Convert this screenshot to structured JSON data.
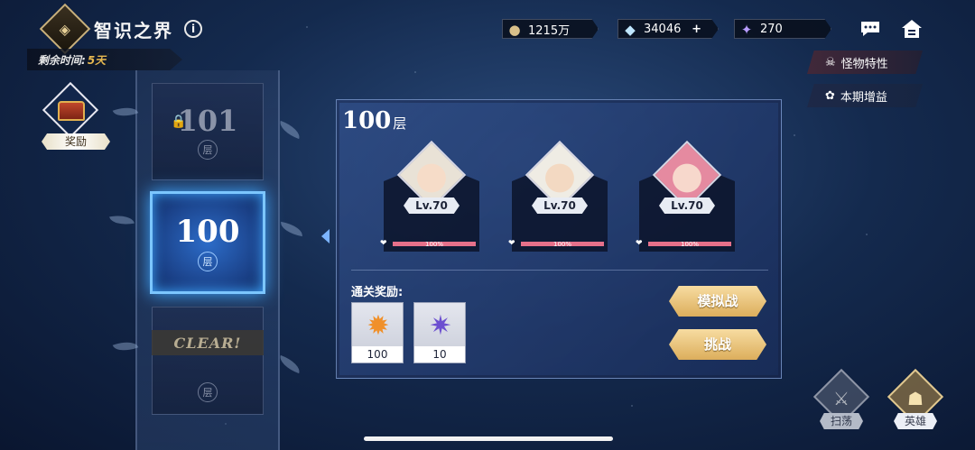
{
  "header": {
    "emblem_icon": "realm-emblem-icon",
    "title": "智识之界",
    "info_icon": "info-icon",
    "time_label": "剩余时间:",
    "time_value": "5天"
  },
  "currencies": [
    {
      "icon": "coin-icon",
      "value": "1215万"
    },
    {
      "icon": "crystal-icon",
      "value": "34046",
      "plus": "+"
    },
    {
      "icon": "star-shard-icon",
      "value": "270"
    }
  ],
  "top_right": {
    "chat_icon": "chat-icon",
    "home_icon": "home-icon"
  },
  "side_buttons": {
    "monster_traits": "怪物特性",
    "period_buff": "本期增益"
  },
  "reward_chest": {
    "label": "奖励"
  },
  "tower": {
    "locked_floor": {
      "number": "101",
      "unit": "层"
    },
    "active_floor": {
      "number": "100",
      "unit": "层"
    },
    "cleared_floor": {
      "unit": "层",
      "clear_text": "CLEAR!"
    }
  },
  "panel": {
    "floor_number": "100",
    "floor_unit": "层",
    "enemies": [
      {
        "level": "Lv.70",
        "hp_percent": 100,
        "hp_text": "100%"
      },
      {
        "level": "Lv.70",
        "hp_percent": 100,
        "hp_text": "100%"
      },
      {
        "level": "Lv.70",
        "hp_percent": 100,
        "hp_text": "100%"
      }
    ],
    "rewards_label": "通关奖励:",
    "rewards": [
      {
        "icon": "sun-medal-icon",
        "qty": "100"
      },
      {
        "icon": "star-shard-icon",
        "qty": "10"
      }
    ],
    "simulate_button": "模拟战",
    "challenge_button": "挑战"
  },
  "corner_buttons": {
    "sweep": "扫荡",
    "hero": "英雄"
  },
  "colors": {
    "accent_gold": "#dcae5c",
    "active_blue": "#7cc6ff",
    "hp_pink": "#e6708a"
  }
}
